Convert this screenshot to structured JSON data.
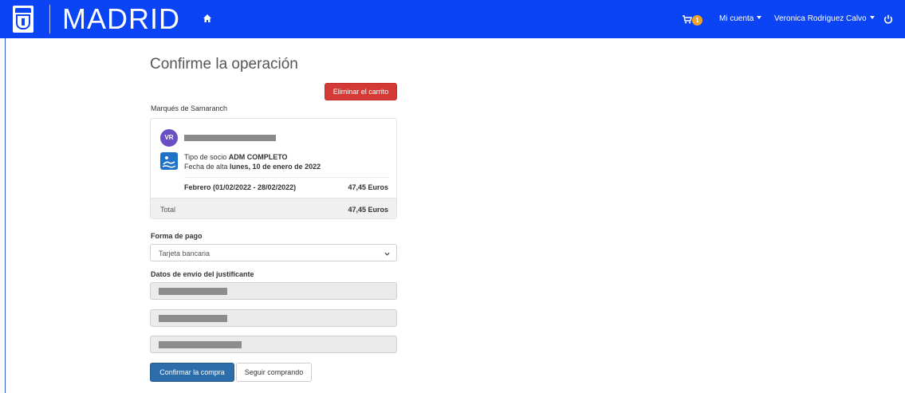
{
  "header": {
    "brand": "MADRID",
    "cart_count": "1",
    "account_menu": "Mi cuenta",
    "user_menu": "Veronica Rodriguez Calvo"
  },
  "page": {
    "title": "Confirme la operación",
    "empty_cart_button": "Eliminar el carrito",
    "venue": "Marqués de Samaranch"
  },
  "card": {
    "avatar_initials": "VR",
    "member_type_prefix": "Tipo de socio ",
    "member_type": "ADM COMPLETO",
    "signup_prefix": "Fecha de alta ",
    "signup_date": "lunes, 10 de enero de 2022",
    "period": "Febrero (01/02/2022 - 28/02/2022)",
    "period_amount": "47,45 Euros",
    "total_label": "Total",
    "total_amount": "47,45 Euros"
  },
  "payment": {
    "label": "Forma de pago",
    "selected": "Tarjeta bancaria"
  },
  "shipping": {
    "label": "Datos de envío del justificante"
  },
  "actions": {
    "confirm": "Confirmar la compra",
    "continue": "Seguir comprando"
  },
  "colors": {
    "navbar": "#0b44f4",
    "danger": "#d33a36",
    "primary": "#2d6daa",
    "badge": "#f2a421",
    "avatar": "#6a4fc4"
  }
}
